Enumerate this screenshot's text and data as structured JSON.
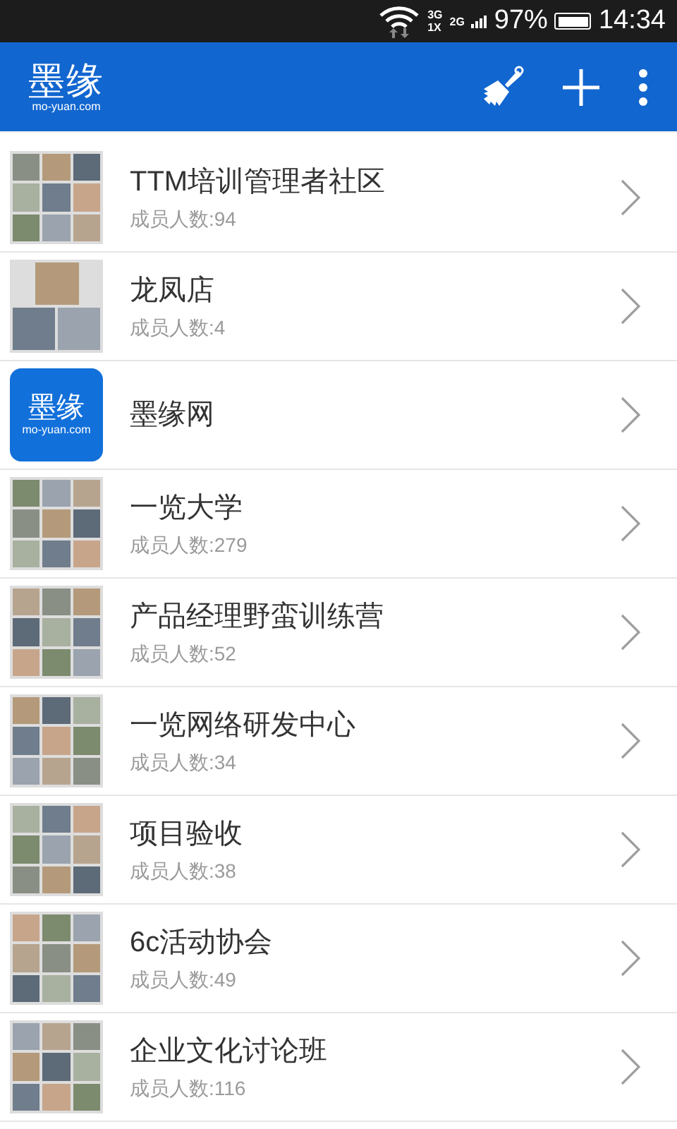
{
  "status_bar": {
    "network_a": "3G",
    "network_b": "1X",
    "network_c": "2G",
    "battery": "97%",
    "time": "14:34"
  },
  "app_bar": {
    "logo": "墨缘",
    "logo_sub": "mo-yuan.com"
  },
  "groups": [
    {
      "name": "TTM培训管理者社区",
      "members": "成员人数:94",
      "avatar": {
        "kind": "mosaic9"
      }
    },
    {
      "name": "龙凤店",
      "members": "成员人数:4",
      "avatar": {
        "kind": "mosaic3"
      }
    },
    {
      "name": "墨缘网",
      "avatar": {
        "kind": "logo",
        "logo": "墨缘",
        "logo_sub": "mo-yuan.com"
      }
    },
    {
      "name": "一览大学",
      "members": "成员人数:279",
      "avatar": {
        "kind": "mosaic9"
      }
    },
    {
      "name": "产品经理野蛮训练营",
      "members": "成员人数:52",
      "avatar": {
        "kind": "mosaic9"
      }
    },
    {
      "name": "一览网络研发中心",
      "members": "成员人数:34",
      "avatar": {
        "kind": "mosaic9"
      }
    },
    {
      "name": "项目验收",
      "members": "成员人数:38",
      "avatar": {
        "kind": "mosaic9"
      }
    },
    {
      "name": "6c活动协会",
      "members": "成员人数:49",
      "avatar": {
        "kind": "mosaic9"
      }
    },
    {
      "name": "企业文化讨论班",
      "members": "成员人数:116",
      "avatar": {
        "kind": "mosaic9"
      }
    }
  ]
}
